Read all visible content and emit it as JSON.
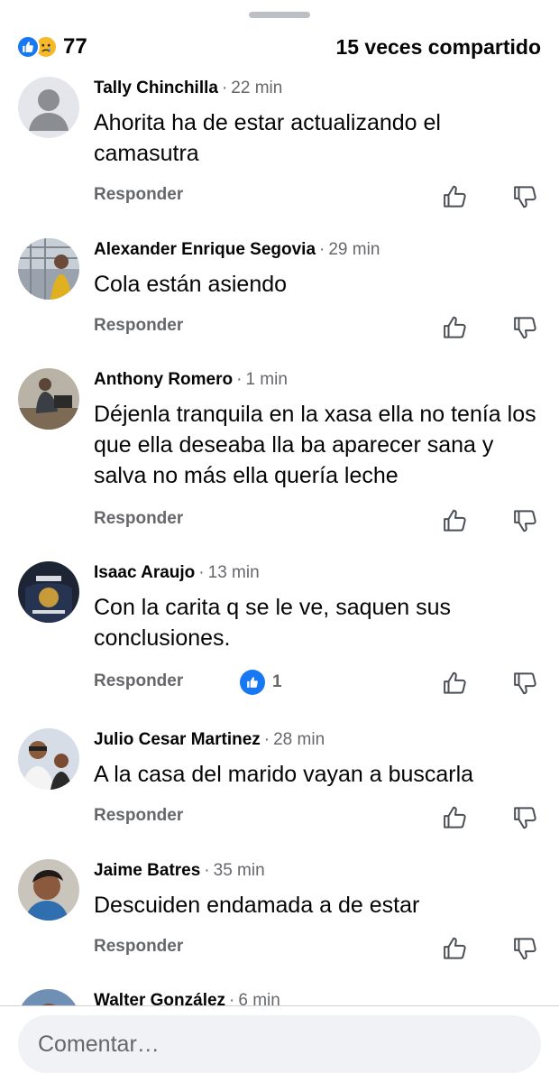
{
  "header": {
    "reaction_icons": [
      "like-icon",
      "sad-icon"
    ],
    "reaction_count": "77",
    "shares": "15 veces compartido"
  },
  "comments": [
    {
      "name": "Tally Chinchilla",
      "time": "22 min",
      "text": "Ahorita ha de estar actualizando el camasutra",
      "reply": "Responder",
      "avatar": "default-avatar"
    },
    {
      "name": "Alexander Enrique Segovia",
      "time": "29 min",
      "text": "Cola están asiendo",
      "reply": "Responder",
      "avatar": "photo-avatar"
    },
    {
      "name": "Anthony Romero",
      "time": "1 min",
      "text": "Déjenla tranquila en la xasa ella no tenía los que ella deseaba lla ba aparecer sana y salva no más ella quería leche",
      "reply": "Responder",
      "avatar": "photo-avatar"
    },
    {
      "name": "Isaac Araujo",
      "time": "13 min",
      "text": "Con la carita q se le ve, saquen sus conclusiones.",
      "reply": "Responder",
      "avatar": "photo-avatar",
      "likes": "1"
    },
    {
      "name": "Julio Cesar Martinez",
      "time": "28 min",
      "text": "A la casa del marido vayan a buscarla",
      "reply": "Responder",
      "avatar": "photo-avatar"
    },
    {
      "name": "Jaime Batres",
      "time": "35 min",
      "text": "Descuiden endamada a de estar",
      "reply": "Responder",
      "avatar": "photo-avatar"
    },
    {
      "name": "Walter González",
      "time": "6 min",
      "avatar": "photo-avatar"
    }
  ],
  "composer": {
    "placeholder": "Comentar…"
  },
  "colors": {
    "accent": "#1877f2",
    "secondary_text": "#65676b",
    "sad_reaction": "#f7b928"
  }
}
